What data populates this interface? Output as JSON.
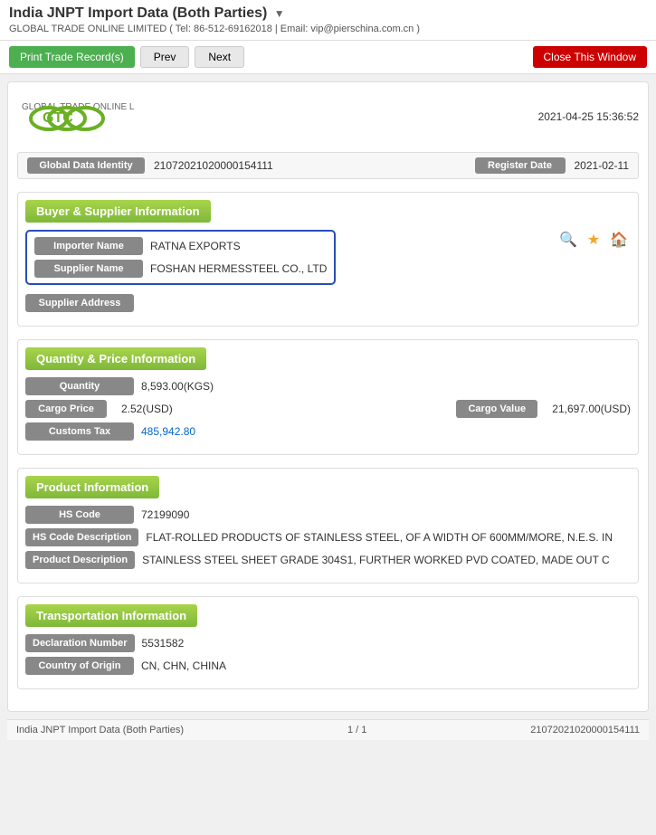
{
  "page": {
    "title": "India JNPT Import Data (Both Parties)",
    "title_arrow": "▼",
    "company_info": "GLOBAL TRADE ONLINE LIMITED ( Tel: 86-512-69162018 | Email: vip@pierschina.com.cn )"
  },
  "toolbar": {
    "print_label": "Print Trade Record(s)",
    "prev_label": "Prev",
    "next_label": "Next",
    "close_label": "Close This Window"
  },
  "timestamp": "2021-04-25 15:36:52",
  "global_data": {
    "identity_label": "Global Data Identity",
    "identity_value": "21072021020000154111",
    "register_label": "Register Date",
    "register_value": "2021-02-11"
  },
  "buyer_supplier": {
    "section_title": "Buyer & Supplier Information",
    "importer_label": "Importer Name",
    "importer_value": "RATNA EXPORTS",
    "supplier_label": "Supplier Name",
    "supplier_value": "FOSHAN HERMESSTEEL CO., LTD",
    "supplier_address_label": "Supplier Address",
    "search_icon": "🔍",
    "star_icon": "★",
    "home_icon": "🏠"
  },
  "quantity_price": {
    "section_title": "Quantity & Price Information",
    "quantity_label": "Quantity",
    "quantity_value": "8,593.00(KGS)",
    "cargo_price_label": "Cargo Price",
    "cargo_price_value": "2.52(USD)",
    "cargo_value_label": "Cargo Value",
    "cargo_value_value": "21,697.00(USD)",
    "customs_tax_label": "Customs Tax",
    "customs_tax_value": "485,942.80"
  },
  "product_info": {
    "section_title": "Product Information",
    "hs_code_label": "HS Code",
    "hs_code_value": "72199090",
    "hs_desc_label": "HS Code Description",
    "hs_desc_value": "FLAT-ROLLED PRODUCTS OF STAINLESS STEEL, OF A WIDTH OF 600MM/MORE, N.E.S. IN",
    "product_desc_label": "Product Description",
    "product_desc_value": "STAINLESS STEEL SHEET GRADE 304S1, FURTHER WORKED PVD COATED, MADE OUT C"
  },
  "transportation": {
    "section_title": "Transportation Information",
    "declaration_label": "Declaration Number",
    "declaration_value": "5531582",
    "country_label": "Country of Origin",
    "country_value": "CN, CHN, CHINA"
  },
  "footer": {
    "left_text": "India JNPT Import Data (Both Parties)",
    "page_info": "1 / 1",
    "record_id": "21072021020000154111"
  }
}
